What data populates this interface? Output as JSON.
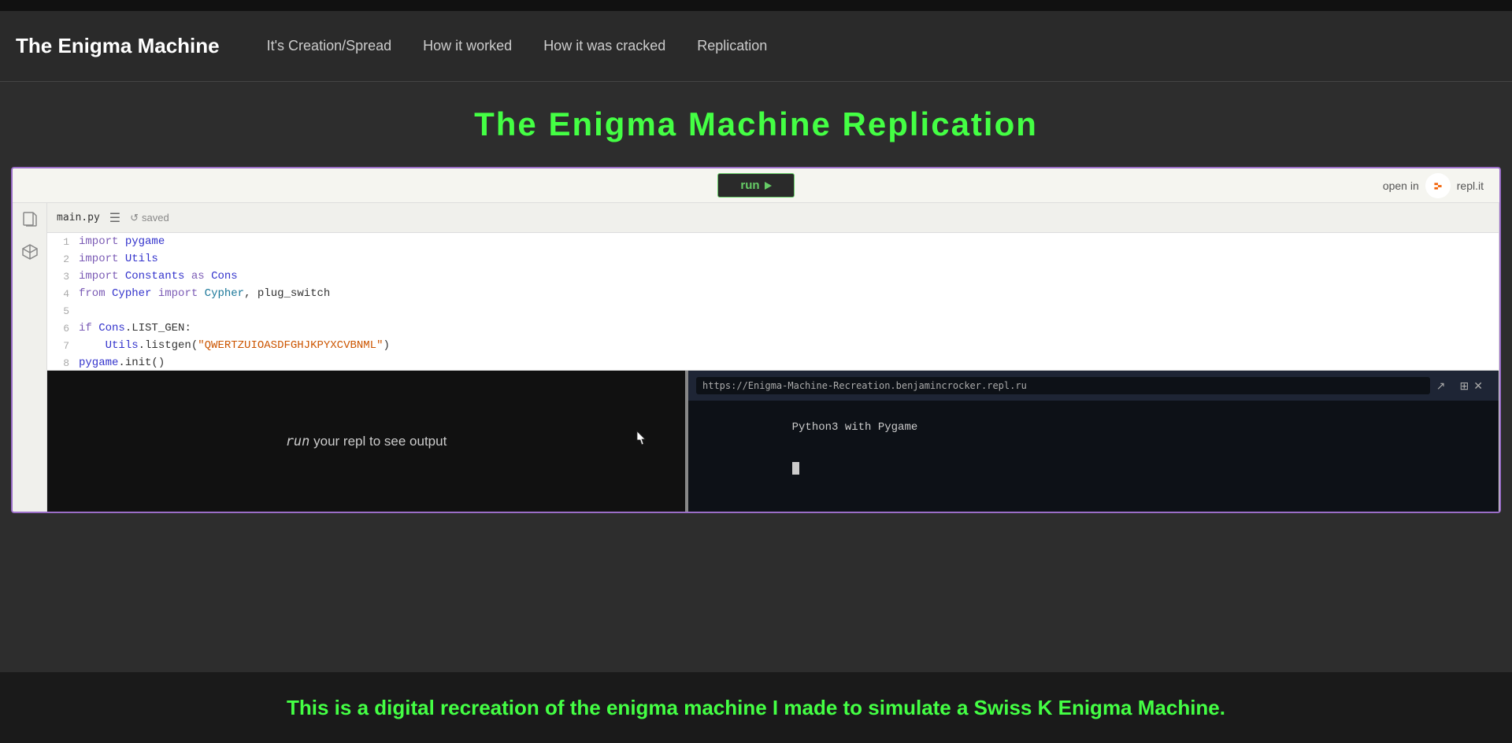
{
  "nav": {
    "title": "The Enigma Machine",
    "links": [
      {
        "label": "It's Creation/Spread",
        "id": "creation"
      },
      {
        "label": "How it worked",
        "id": "how-worked"
      },
      {
        "label": "How it was cracked",
        "id": "how-cracked"
      },
      {
        "label": "Replication",
        "id": "replication"
      }
    ]
  },
  "page": {
    "title": "The Enigma Machine Replication"
  },
  "repl": {
    "run_button": "run",
    "open_in_label": "open in",
    "open_in_site": "repl.it",
    "tab_name": "main.py",
    "saved_label": "saved",
    "code_lines": [
      {
        "num": "1",
        "content": "import pygame"
      },
      {
        "num": "2",
        "content": "import Utils"
      },
      {
        "num": "3",
        "content": "import Constants as Cons"
      },
      {
        "num": "4",
        "content": "from Cypher import Cypher, plug_switch"
      },
      {
        "num": "5",
        "content": ""
      },
      {
        "num": "6",
        "content": "if Cons.LIST_GEN:"
      },
      {
        "num": "7",
        "content": "    Utils.listgen(\"QWERTZUIOASDFGHJKPYXCVBNML\")"
      },
      {
        "num": "8",
        "content": "pygame.init()"
      }
    ]
  },
  "console": {
    "text_pre": "run",
    "text_post": " your repl to see output"
  },
  "browser": {
    "address": "https://Enigma-Machine-Recreation.benjamincrocker.repl.ru",
    "terminal_line1": "Python3 with Pygame"
  },
  "footer": {
    "text": "This is a digital recreation of the enigma machine I made to simulate a Swiss K Enigma Machine."
  }
}
